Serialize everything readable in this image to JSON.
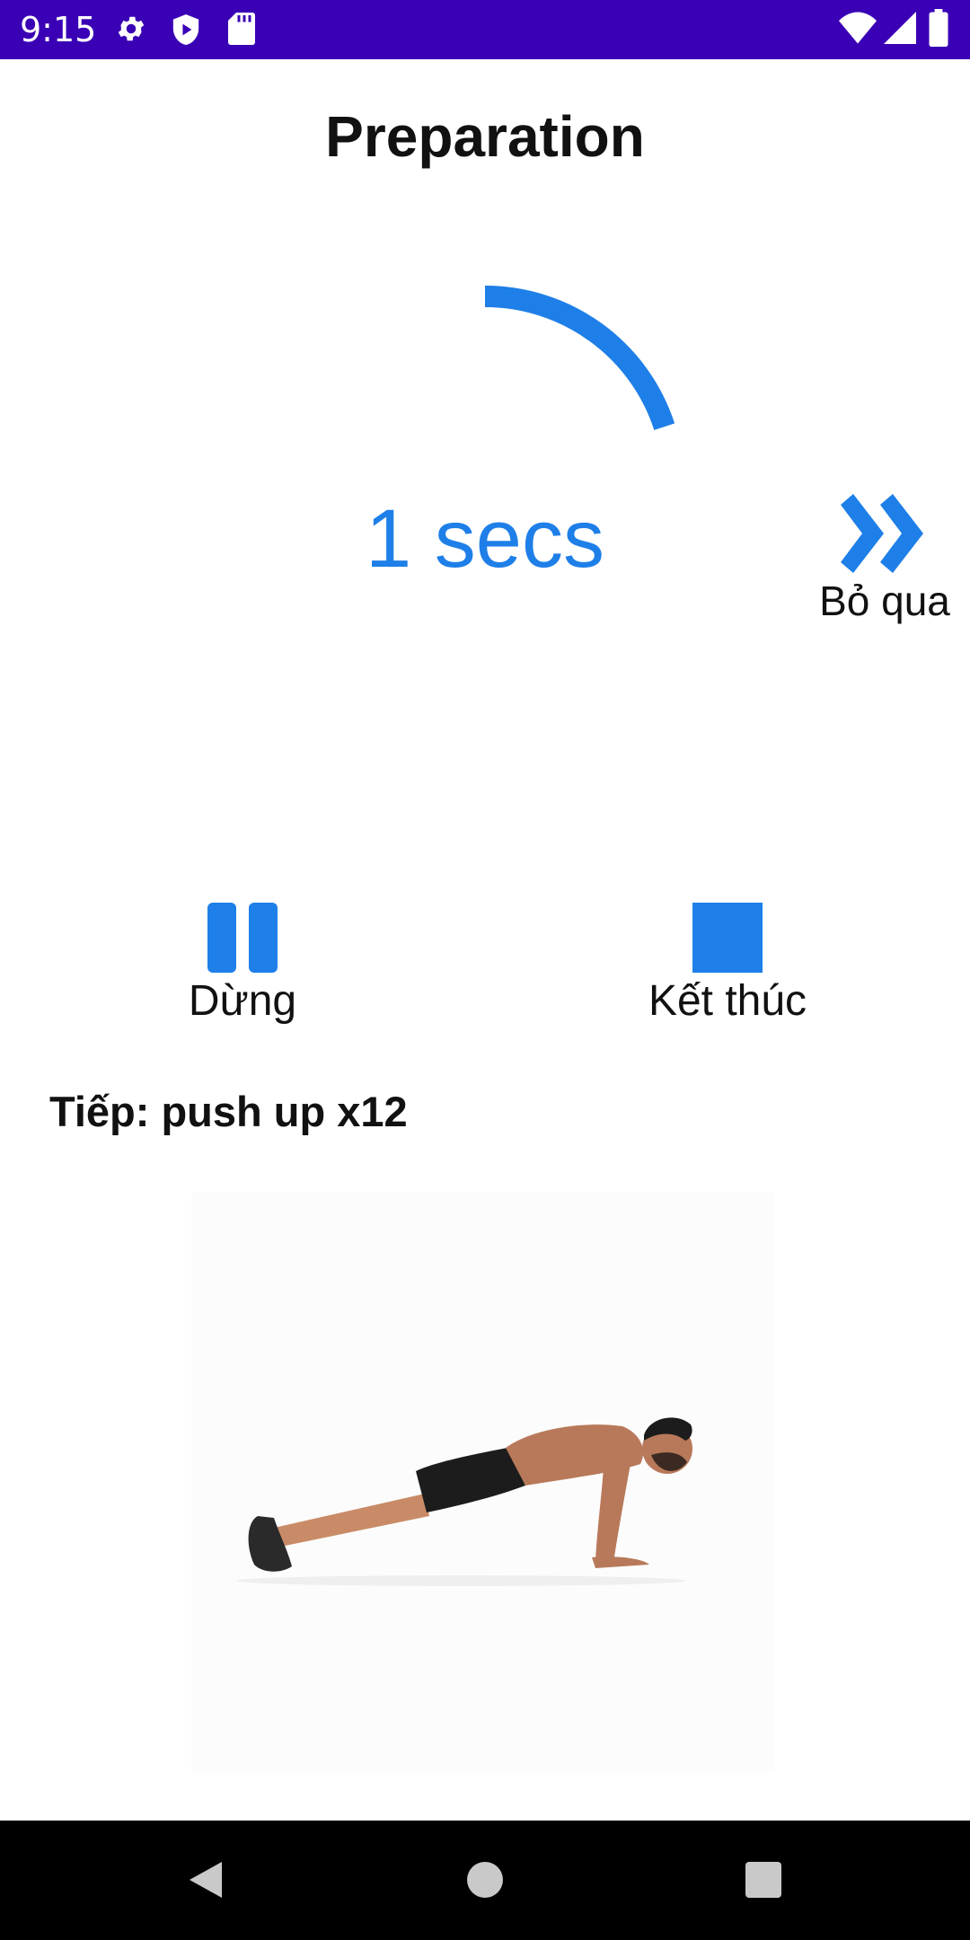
{
  "status_bar": {
    "time": "9:15",
    "background": "#3a00b5",
    "left_icons": [
      "settings-icon",
      "shield-icon",
      "sd-card-icon"
    ],
    "right_icons": [
      "wifi-icon",
      "signal-icon",
      "battery-icon"
    ]
  },
  "screen": {
    "title": "Preparation",
    "timer_text": "1 secs",
    "accent_color": "#1e7fe8"
  },
  "progress": {
    "fraction_elapsed": 0.2
  },
  "controls": {
    "skip_label": "Bỏ qua",
    "pause_label": "Dừng",
    "stop_label": "Kết thúc"
  },
  "next_exercise": {
    "label": "Tiếp: push up  x12"
  },
  "nav_bar": {
    "buttons": [
      "back-icon",
      "home-icon",
      "recents-icon"
    ]
  }
}
